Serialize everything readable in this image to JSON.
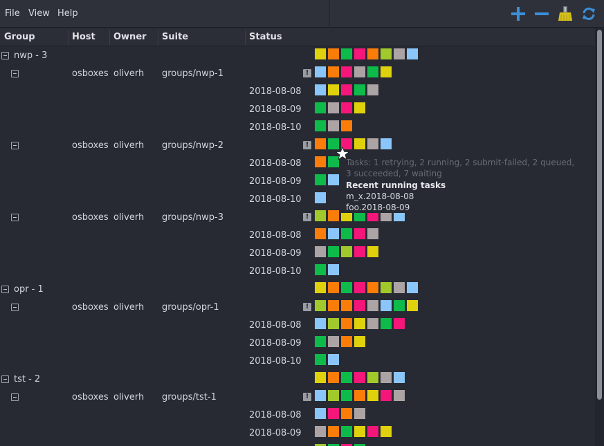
{
  "menu": {
    "file": "File",
    "view": "View",
    "help": "Help"
  },
  "toolbar": {
    "expand_icon": "plus-icon",
    "collapse_icon": "minus-icon",
    "clean_icon": "broom-icon",
    "refresh_icon": "refresh-icon"
  },
  "columns": {
    "group": "Group",
    "host": "Host",
    "owner": "Owner",
    "suite": "Suite",
    "status": "Status"
  },
  "colors": {
    "Y": "#dfd20d",
    "O": "#fa7d0a",
    "G": "#0ebb4a",
    "P": "#f5167a",
    "L": "#a2c92b",
    "S": "#aca3a4",
    "B": "#8ac6f9",
    "background": "#272a33",
    "warn": "#9a9ca3"
  },
  "rows": [
    {
      "type": "group",
      "label": "nwp - 3",
      "status": [
        "Y",
        "O",
        "G",
        "P",
        "O",
        "L",
        "S",
        "B"
      ]
    },
    {
      "type": "suite",
      "host": "osboxes",
      "owner": "oliverh",
      "suite": "groups/nwp-1",
      "warn": true,
      "status": [
        "B",
        "O",
        "P",
        "S",
        "G",
        "Y"
      ]
    },
    {
      "type": "cycle",
      "cycle": "2018-08-08",
      "status": [
        "B",
        "Y",
        "P",
        "G",
        "S"
      ]
    },
    {
      "type": "cycle",
      "cycle": "2018-08-09",
      "status": [
        "G",
        "S",
        "P",
        "Y"
      ]
    },
    {
      "type": "cycle",
      "cycle": "2018-08-10",
      "status": [
        "G",
        "S",
        "O"
      ]
    },
    {
      "type": "suite",
      "host": "osboxes",
      "owner": "oliverh",
      "suite": "groups/nwp-2",
      "warn": true,
      "status": [
        "O",
        "G",
        "P",
        "Y",
        "S",
        "B"
      ]
    },
    {
      "type": "cycle",
      "cycle": "2018-08-08",
      "status": [
        "O",
        "G"
      ]
    },
    {
      "type": "cycle",
      "cycle": "2018-08-09",
      "status": [
        "G",
        "B"
      ]
    },
    {
      "type": "cycle",
      "cycle": "2018-08-10",
      "status": [
        "B"
      ]
    },
    {
      "type": "suite",
      "host": "osboxes",
      "owner": "oliverh",
      "suite": "groups/nwp-3",
      "warn": true,
      "status": [
        "L",
        "O",
        "Y",
        "G",
        "P",
        "S",
        "B"
      ]
    },
    {
      "type": "cycle",
      "cycle": "2018-08-08",
      "status": [
        "O",
        "B",
        "G",
        "P",
        "S"
      ]
    },
    {
      "type": "cycle",
      "cycle": "2018-08-09",
      "status": [
        "S",
        "G",
        "L",
        "P",
        "Y"
      ]
    },
    {
      "type": "cycle",
      "cycle": "2018-08-10",
      "status": [
        "G",
        "B"
      ]
    },
    {
      "type": "group",
      "label": "opr - 1",
      "status": [
        "Y",
        "O",
        "G",
        "P",
        "O",
        "L",
        "S",
        "B"
      ]
    },
    {
      "type": "suite",
      "host": "osboxes",
      "owner": "oliverh",
      "suite": "groups/opr-1",
      "warn": true,
      "status": [
        "L",
        "O",
        "O",
        "P",
        "S",
        "B",
        "G",
        "Y"
      ]
    },
    {
      "type": "cycle",
      "cycle": "2018-08-08",
      "status": [
        "B",
        "L",
        "O",
        "Y",
        "S",
        "G",
        "P"
      ]
    },
    {
      "type": "cycle",
      "cycle": "2018-08-09",
      "status": [
        "G",
        "S",
        "O",
        "Y"
      ]
    },
    {
      "type": "cycle",
      "cycle": "2018-08-10",
      "status": [
        "G",
        "B"
      ]
    },
    {
      "type": "group",
      "label": "tst - 2",
      "status": [
        "Y",
        "O",
        "G",
        "P",
        "L",
        "S",
        "B"
      ]
    },
    {
      "type": "suite",
      "host": "osboxes",
      "owner": "oliverh",
      "suite": "groups/tst-1",
      "warn": true,
      "status": [
        "B",
        "L",
        "G",
        "O",
        "Y",
        "P",
        "S"
      ]
    },
    {
      "type": "cycle",
      "cycle": "2018-08-08",
      "status": [
        "B",
        "P",
        "O",
        "S"
      ]
    },
    {
      "type": "cycle",
      "cycle": "2018-08-09",
      "status": [
        "S",
        "O",
        "G",
        "Y",
        "P",
        "Y"
      ]
    },
    {
      "type": "cycle",
      "cycle": "",
      "status": [
        "L",
        "G",
        "P",
        "G"
      ]
    }
  ],
  "tooltip": {
    "summary": "Tasks: 1 retrying, 2 running, 2 submit-failed, 2 queued, 3 succeeded, 7 waiting",
    "recent_heading": "Recent running tasks",
    "task1": "m_x.2018-08-08",
    "task2": "foo.2018-08-09"
  }
}
